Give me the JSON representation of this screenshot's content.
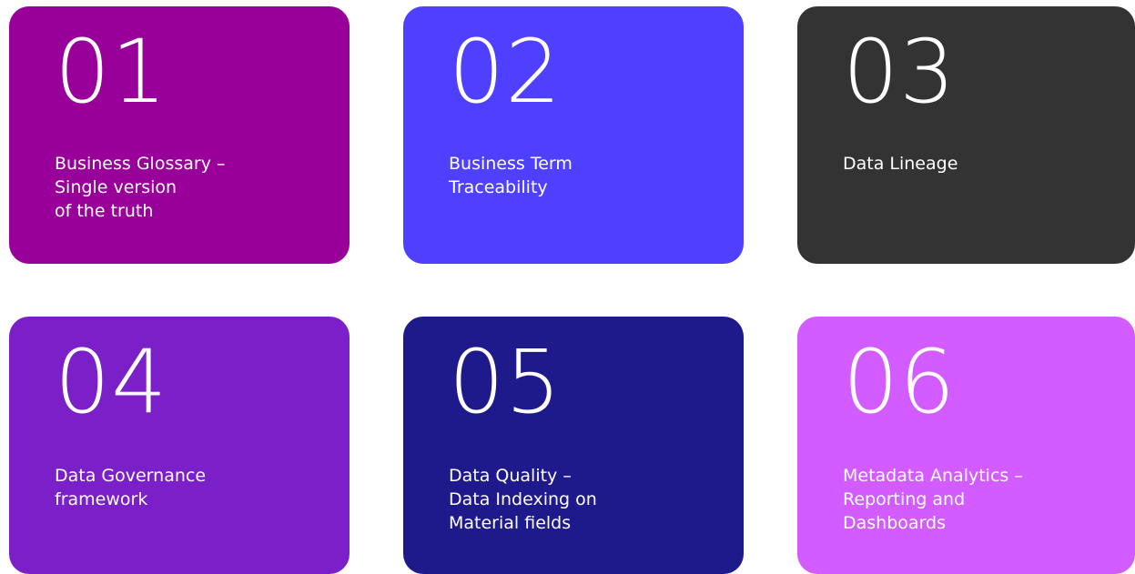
{
  "cards": [
    {
      "number": "01",
      "lines": [
        "Business Glossary –",
        "Single version",
        "of the truth"
      ],
      "color": "#990099"
    },
    {
      "number": "02",
      "lines": [
        "Business Term",
        "Traceability"
      ],
      "color": "#4f40ff"
    },
    {
      "number": "03",
      "lines": [
        "Data Lineage"
      ],
      "color": "#333333"
    },
    {
      "number": "04",
      "lines": [
        "Data Governance",
        "framework"
      ],
      "color": "#7b1fc8"
    },
    {
      "number": "05",
      "lines": [
        "Data Quality –",
        "Data Indexing on",
        "Material fields"
      ],
      "color": "#1f1a8c"
    },
    {
      "number": "06",
      "lines": [
        "Metadata Analytics –",
        "Reporting and",
        "Dashboards"
      ],
      "color": "#d25cff"
    }
  ]
}
